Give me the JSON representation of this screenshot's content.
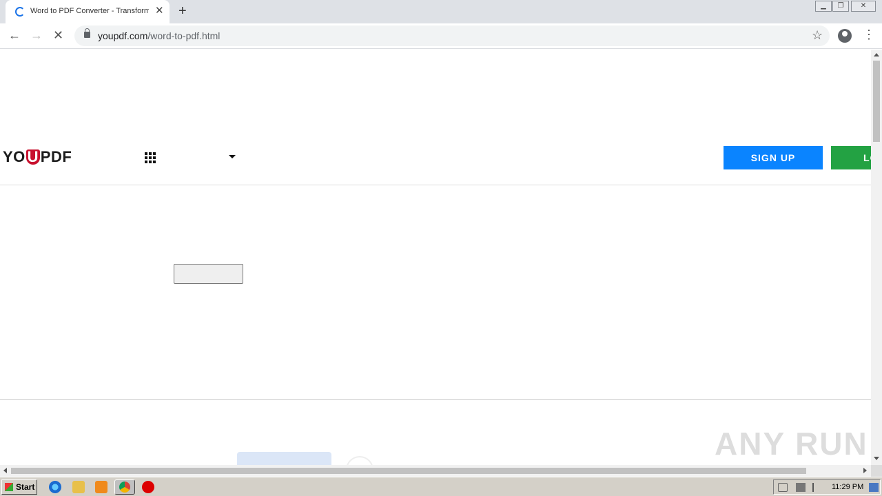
{
  "browser": {
    "tab_title": "Word to PDF Converter - Transform",
    "tab_close": "✕",
    "new_tab": "+",
    "url_domain": "youpdf.com",
    "url_path": "/word-to-pdf.html",
    "window_controls": {
      "minimize": "▁",
      "restore": "❐",
      "close": "✕"
    }
  },
  "nav": {
    "back": "←",
    "forward": "→",
    "stop": "✕",
    "star": "☆",
    "menu": "⋮"
  },
  "site": {
    "logo_left": "YO",
    "logo_u": "U",
    "logo_right": "PDF",
    "signup_label": "SIGN UP",
    "login_label": "LOGIN"
  },
  "watermark": "ANY RUN",
  "taskbar": {
    "start_label": "Start",
    "clock": "11:29 PM"
  },
  "colors": {
    "signup": "#0a84ff",
    "login": "#23a243",
    "logo_accent": "#c8102e"
  }
}
